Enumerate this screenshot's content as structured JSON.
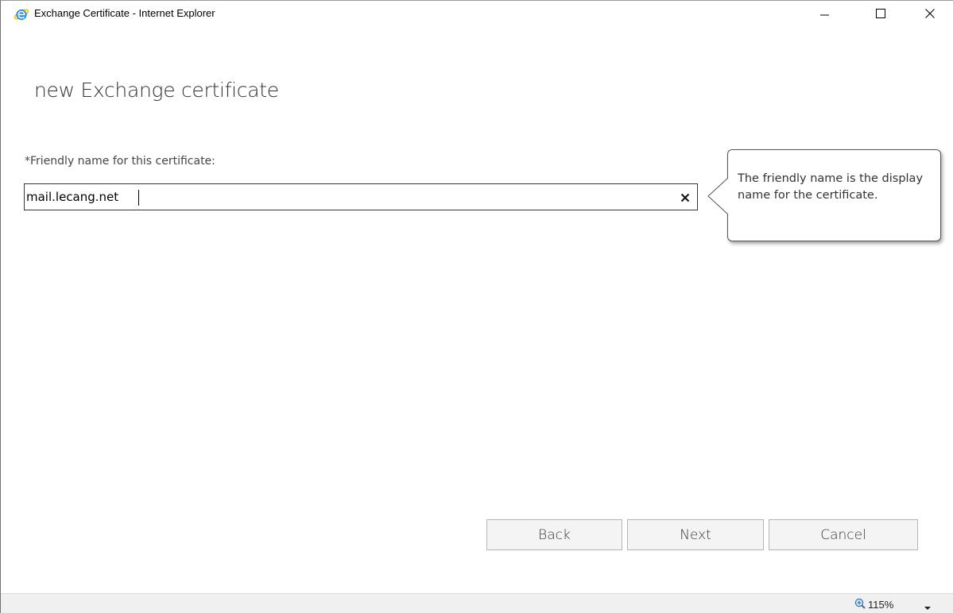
{
  "window": {
    "title": "Exchange Certificate - Internet Explorer"
  },
  "icons": {
    "app": "internet-explorer-icon",
    "minimize": "minimize-icon",
    "maximize": "maximize-icon",
    "close": "close-icon",
    "clear": "clear-icon",
    "zoom": "zoom-icon",
    "dropdown": "chevron-down-icon"
  },
  "page": {
    "title": "new Exchange certificate"
  },
  "form": {
    "friendly_name_label": "*Friendly name for this certificate:",
    "friendly_name_value": "mail.lecang.net"
  },
  "callout": {
    "text": "The friendly name is the display name for the certificate."
  },
  "buttons": {
    "back": "Back",
    "next": "Next",
    "cancel": "Cancel"
  },
  "statusbar": {
    "zoom": "115%"
  },
  "colors": {
    "ie_blue": "#1e8fe0",
    "ie_ring": "#f7c325",
    "button_bg": "#f4f4f4",
    "statusbar_bg": "#f0f0f0"
  }
}
